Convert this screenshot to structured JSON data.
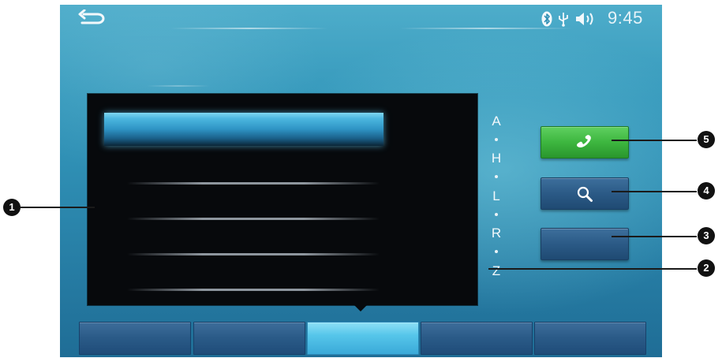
{
  "status_bar": {
    "time": "9:45",
    "icons": [
      "bluetooth-icon",
      "usb-icon",
      "volume-icon"
    ]
  },
  "alphabet_index": {
    "letters": [
      "A",
      "H",
      "L",
      "R",
      "Z"
    ],
    "separator": "·"
  },
  "side_buttons": [
    {
      "name": "call-button",
      "icon": "phone-icon",
      "color": "#3db63f"
    },
    {
      "name": "search-button",
      "icon": "magnifier-icon",
      "color": "#2b5a86"
    },
    {
      "name": "blank-button",
      "icon": "",
      "color": "#2b5a86"
    }
  ],
  "tab_bar": {
    "tab_count": 5,
    "active_index": 2
  },
  "callouts": {
    "c1": "1",
    "c2": "2",
    "c3": "3",
    "c4": "4",
    "c5": "5"
  },
  "colors": {
    "background_top": "#3fa6c6",
    "background_bottom": "#1f6d96",
    "list_panel": "#07090c",
    "selection": "#2e93c4",
    "active_tab": "#56c6ea"
  }
}
